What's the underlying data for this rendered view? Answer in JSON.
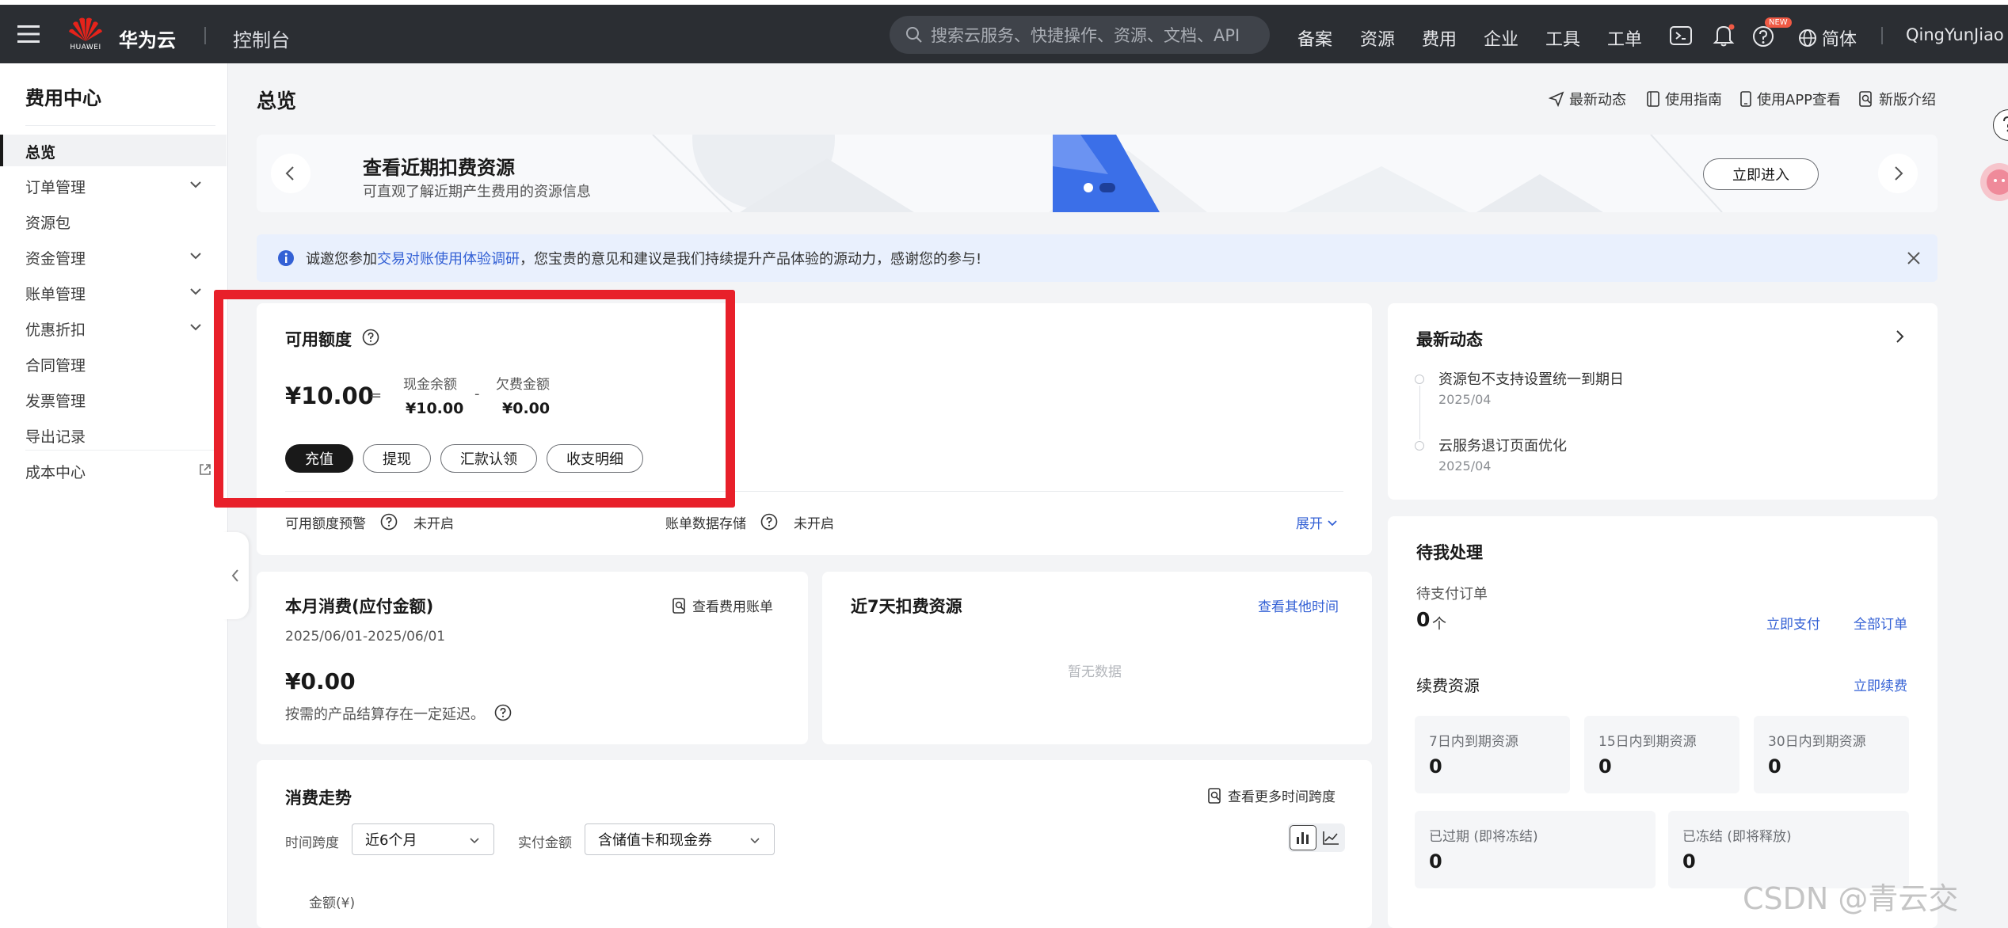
{
  "topbar": {
    "logo_text": "HUAWEI",
    "brand": "华为云",
    "console": "控制台",
    "search_placeholder": "搜索云服务、快捷操作、资源、文档、API",
    "nav": [
      "备案",
      "资源",
      "费用",
      "企业",
      "工具",
      "工单"
    ],
    "new_badge": "NEW",
    "language": "简体",
    "user": "QingYunJiao"
  },
  "sidebar": {
    "title": "费用中心",
    "items": [
      {
        "label": "总览",
        "active": true,
        "expandable": false
      },
      {
        "label": "订单管理",
        "expandable": true
      },
      {
        "label": "资源包",
        "expandable": false
      },
      {
        "label": "资金管理",
        "expandable": true
      },
      {
        "label": "账单管理",
        "expandable": true
      },
      {
        "label": "优惠折扣",
        "expandable": true
      },
      {
        "label": "合同管理",
        "expandable": false
      },
      {
        "label": "发票管理",
        "expandable": false
      },
      {
        "label": "导出记录",
        "expandable": false
      },
      {
        "label": "成本中心",
        "expandable": false,
        "external": true
      }
    ]
  },
  "header": {
    "title": "总览",
    "links": [
      "最新动态",
      "使用指南",
      "使用APP查看",
      "新版介绍"
    ]
  },
  "banner": {
    "title": "查看近期扣费资源",
    "subtitle": "可直观了解近期产生费用的资源信息",
    "button": "立即进入"
  },
  "notice": {
    "prefix": "诚邀您参加",
    "link": "交易对账使用体验调研",
    "suffix": "，您宝贵的意见和建议是我们持续提升产品体验的源动力，感谢您的参与!"
  },
  "balance": {
    "title": "可用额度",
    "total": "¥10.00",
    "equals": "=",
    "minus": "-",
    "cash_label": "现金余额",
    "cash_value": "¥10.00",
    "debt_label": "欠费金额",
    "debt_value": "¥0.00",
    "buttons": [
      "充值",
      "提现",
      "汇款认领",
      "收支明细"
    ],
    "alert_label": "可用额度预警",
    "alert_value": "未开启",
    "storage_label": "账单数据存储",
    "storage_value": "未开启",
    "expand": "展开"
  },
  "monthly": {
    "title": "本月消费(应付金额)",
    "link": "查看费用账单",
    "date_range": "2025/06/01-2025/06/01",
    "amount": "¥0.00",
    "note": "按需的产品结算存在一定延迟。"
  },
  "recent7": {
    "title": "近7天扣费资源",
    "link": "查看其他时间",
    "empty": "暂无数据"
  },
  "trend": {
    "title": "消费走势",
    "link": "查看更多时间跨度",
    "span_label": "时间跨度",
    "span_value": "近6个月",
    "amount_label": "实付金额",
    "amount_value": "含储值卡和现金券",
    "y_label": "金额(¥)"
  },
  "news": {
    "title": "最新动态",
    "items": [
      {
        "text": "资源包不支持设置统一到期日",
        "date": "2025/04"
      },
      {
        "text": "云服务退订页面优化",
        "date": "2025/04"
      }
    ]
  },
  "todo": {
    "title": "待我处理",
    "pending_label": "待支付订单",
    "pending_count": "0",
    "pending_unit": "个",
    "pay_now": "立即支付",
    "all_orders": "全部订单",
    "renew_title": "续费资源",
    "renew_now": "立即续费",
    "expire_cards": [
      {
        "label": "7日内到期资源",
        "value": "0"
      },
      {
        "label": "15日内到期资源",
        "value": "0"
      },
      {
        "label": "30日内到期资源",
        "value": "0"
      }
    ],
    "status_cards": [
      {
        "label": "已过期 (即将冻结)",
        "value": "0"
      },
      {
        "label": "已冻结 (即将释放)",
        "value": "0"
      }
    ]
  },
  "watermark": "CSDN @青云交",
  "colors": {
    "highlight": "#e8202a",
    "link": "#3461d5",
    "topbar": "#2b2e33"
  }
}
